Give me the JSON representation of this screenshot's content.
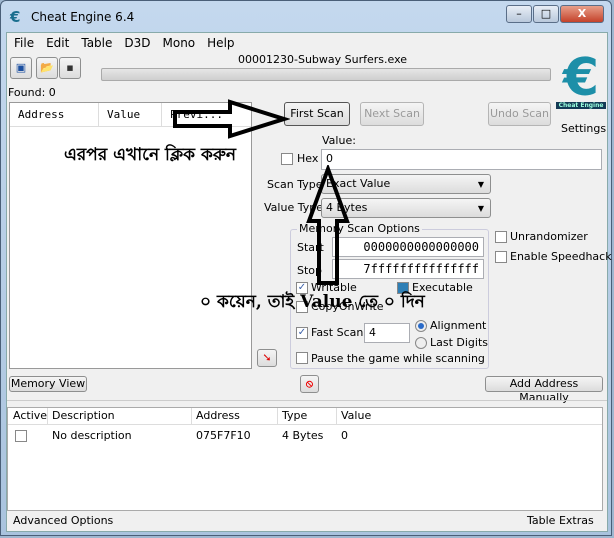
{
  "window": {
    "title": "Cheat Engine 6.4",
    "minimize": "–",
    "maximize": "□",
    "close": "X"
  },
  "menu": [
    "File",
    "Edit",
    "Table",
    "D3D",
    "Mono",
    "Help"
  ],
  "process": "00001230-Subway Surfers.exe",
  "found": "Found: 0",
  "results_columns": [
    "Address",
    "Value",
    "Previ..."
  ],
  "buttons": {
    "first_scan": "First Scan",
    "next_scan": "Next Scan",
    "undo_scan": "Undo Scan",
    "settings": "Settings",
    "memory_view": "Memory View",
    "add_address": "Add Address Manually"
  },
  "scan": {
    "value_label": "Value:",
    "hex_label": "Hex",
    "value": "0",
    "scan_type_label": "Scan Type",
    "scan_type": "Exact Value",
    "value_type_label": "Value Type",
    "value_type": "4 Bytes"
  },
  "memory_options": {
    "title": "Memory Scan Options",
    "start_label": "Start",
    "start": "0000000000000000",
    "stop_label": "Stop",
    "stop": "7fffffffffffffff",
    "writable": "Writable",
    "executable": "Executable",
    "copy_on_write": "CopyOnWrite",
    "fast_scan": "Fast Scan",
    "fast_scan_value": "4",
    "alignment": "Alignment",
    "last_digits": "Last Digits",
    "pause": "Pause the game while scanning"
  },
  "side_options": {
    "unrandomizer": "Unrandomizer",
    "speedhack": "Enable Speedhack"
  },
  "table": {
    "columns": [
      "Active",
      "Description",
      "Address",
      "Type",
      "Value"
    ],
    "rows": [
      {
        "description": "No description",
        "address": "075F7F10",
        "type": "4 Bytes",
        "value": "0"
      }
    ]
  },
  "footer": {
    "advanced": "Advanced Options",
    "extras": "Table Extras"
  },
  "annotations": {
    "click_here": "এরপর এখানে ক্লিক করুন",
    "value_hint": "০ কয়েন, তাই Value তে ০ দিন"
  },
  "logo_text": "Cheat Engine"
}
